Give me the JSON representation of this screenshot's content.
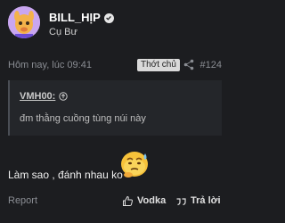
{
  "user": {
    "name": "BILL_HỊP",
    "title": "Cụ Bư"
  },
  "meta": {
    "timestamp": "Hôm nay, lúc 09:41",
    "op_badge": "Thớt chủ",
    "post_number": "#124"
  },
  "quote": {
    "author": "VMH00:",
    "text": "đm thằng cuồng tùng núi này"
  },
  "body": {
    "text": "Làm sao , đánh nhau ko"
  },
  "actions": {
    "report": "Report",
    "like_label": "Vodka",
    "reply_label": "Trả lời"
  },
  "icons": {
    "verified": "verified-check-icon",
    "share": "share-icon",
    "quote_up": "up-arrow-icon",
    "like": "thumbs-up-icon",
    "reply": "quote-reply-icon",
    "emoji": "thinking-sweat-emoji"
  },
  "colors": {
    "background": "#1c1d20",
    "quote_background": "#24262a",
    "badge_background": "#d9d9d9"
  }
}
